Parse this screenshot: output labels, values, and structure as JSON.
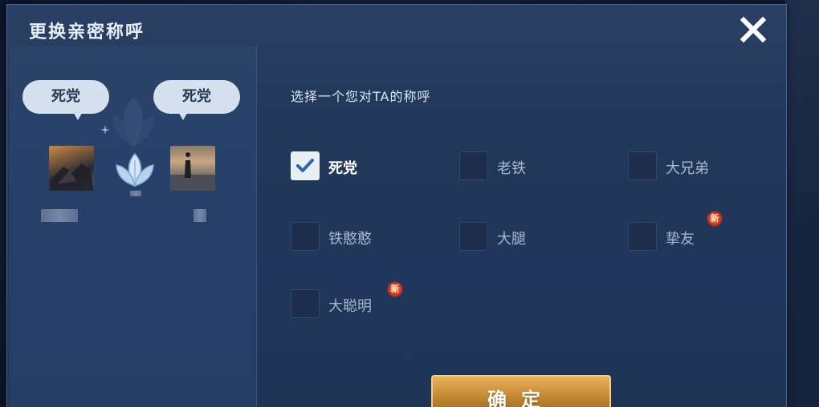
{
  "dialog": {
    "title": "更换亲密称呼",
    "close_icon": "close-x-icon"
  },
  "left_panel": {
    "bubble_left": "死党",
    "bubble_right": "死党",
    "emblem_icon": "intimacy-lotus-emblem-icon"
  },
  "instruction": "选择一个您对TA的称呼",
  "options": [
    {
      "label": "死党",
      "checked": true,
      "is_new": false
    },
    {
      "label": "老铁",
      "checked": false,
      "is_new": false
    },
    {
      "label": "大兄弟",
      "checked": false,
      "is_new": false
    },
    {
      "label": "铁憨憨",
      "checked": false,
      "is_new": false
    },
    {
      "label": "大腿",
      "checked": false,
      "is_new": false
    },
    {
      "label": "挚友",
      "checked": false,
      "is_new": true
    },
    {
      "label": "大聪明",
      "checked": false,
      "is_new": true
    }
  ],
  "badges": {
    "new": "新"
  },
  "confirm_label": "确定",
  "colors": {
    "dialog_bg": "#22385a",
    "left_panel_bg": "#26406a",
    "confirm_gold": "#c58a33",
    "new_badge": "#d1321f"
  }
}
